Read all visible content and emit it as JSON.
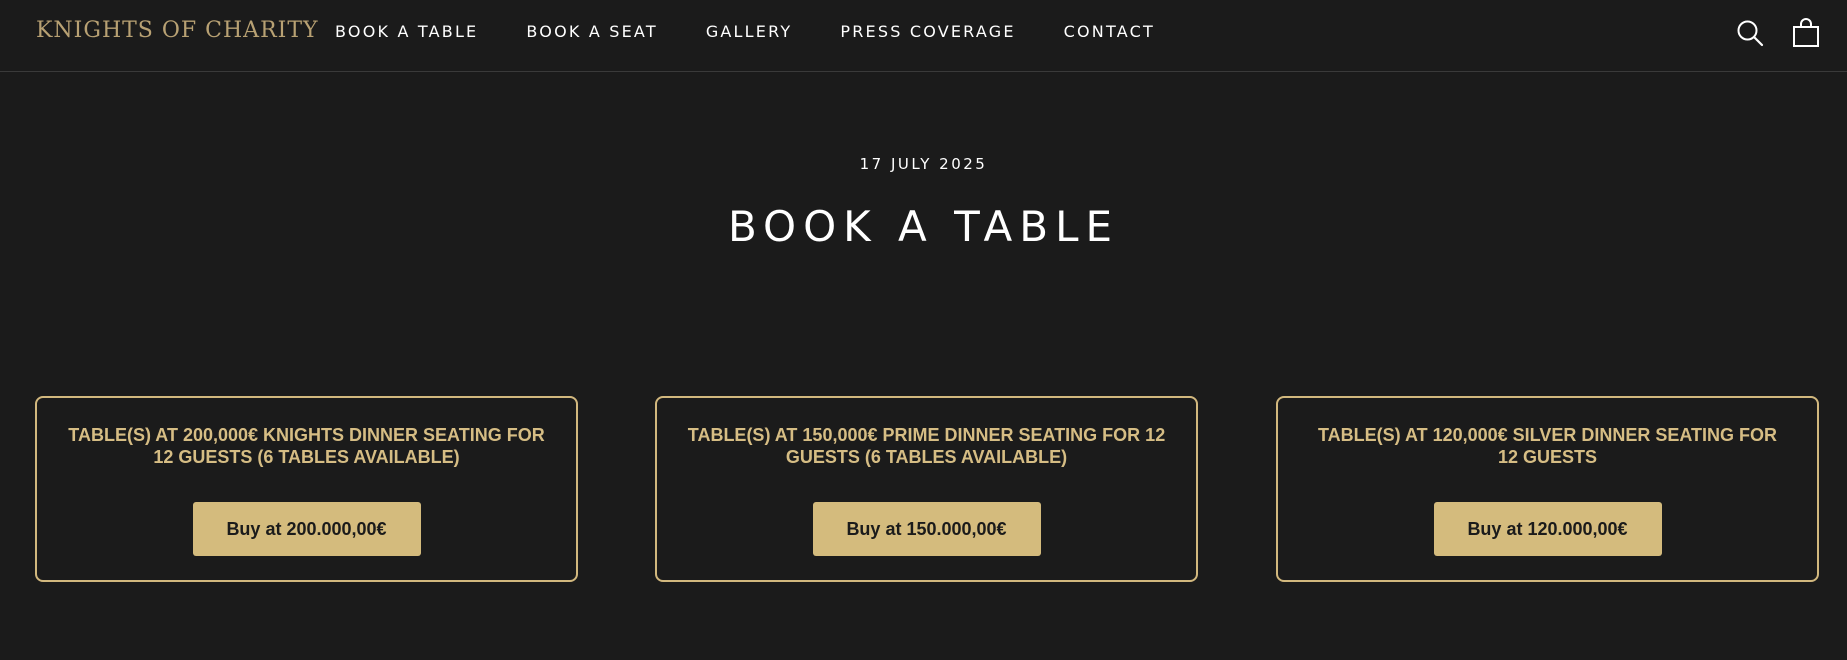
{
  "header": {
    "logo": "KNIGHTS OF CHARITY",
    "nav": [
      {
        "label": "BOOK A TABLE"
      },
      {
        "label": "BOOK A SEAT"
      },
      {
        "label": "GALLERY"
      },
      {
        "label": "PRESS COVERAGE"
      },
      {
        "label": "CONTACT"
      }
    ],
    "icons": [
      "search-icon",
      "shopping-bag-icon"
    ]
  },
  "hero": {
    "date": "17 JULY 2025",
    "title": "BOOK A TABLE"
  },
  "cards": [
    {
      "title": "TABLE(S) AT 200,000€ KNIGHTS DINNER SEATING FOR 12 GUESTS (6 TABLES AVAILABLE)",
      "button": "Buy at 200.000,00€"
    },
    {
      "title": "TABLE(S) AT 150,000€ PRIME DINNER SEATING FOR 12 GUESTS (6 TABLES AVAILABLE)",
      "button": "Buy at 150.000,00€"
    },
    {
      "title": "TABLE(S) AT 120,000€ SILVER DINNER SEATING FOR 12 GUESTS",
      "button": "Buy at 120.000,00€"
    }
  ],
  "colors": {
    "background": "#1b1b1b",
    "accent": "#d4bb7d",
    "text": "#ffffff"
  }
}
